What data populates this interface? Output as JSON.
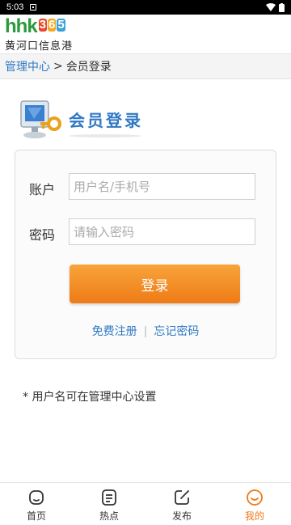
{
  "status_bar": {
    "time": "5:03"
  },
  "header": {
    "logo_letters": "hhk",
    "logo_digits": [
      "3",
      "6",
      "5"
    ],
    "logo_digit_colors": [
      "#e8452c",
      "#f5a623",
      "#3aa0d8"
    ],
    "site_name": "黄河口信息港"
  },
  "breadcrumb": {
    "link": "管理中心",
    "separator": ">",
    "current": "会员登录"
  },
  "login": {
    "title": "会员登录",
    "account_label": "账户",
    "account_placeholder": "用户名/手机号",
    "password_label": "密码",
    "password_placeholder": "请输入密码",
    "submit_label": "登录",
    "register_link": "免费注册",
    "link_divider": "|",
    "forgot_link": "忘记密码"
  },
  "note": "* 用户名可在管理中心设置",
  "tabbar": {
    "items": [
      {
        "label": "首页",
        "icon": "home-icon",
        "active": false
      },
      {
        "label": "热点",
        "icon": "document-icon",
        "active": false
      },
      {
        "label": "发布",
        "icon": "edit-icon",
        "active": false
      },
      {
        "label": "我的",
        "icon": "smiley-icon",
        "active": true
      }
    ]
  },
  "colors": {
    "accent": "#2f78c4",
    "button": "#f28a22",
    "active_tab": "#ef7a1a",
    "logo_green": "#2a9a3c"
  }
}
